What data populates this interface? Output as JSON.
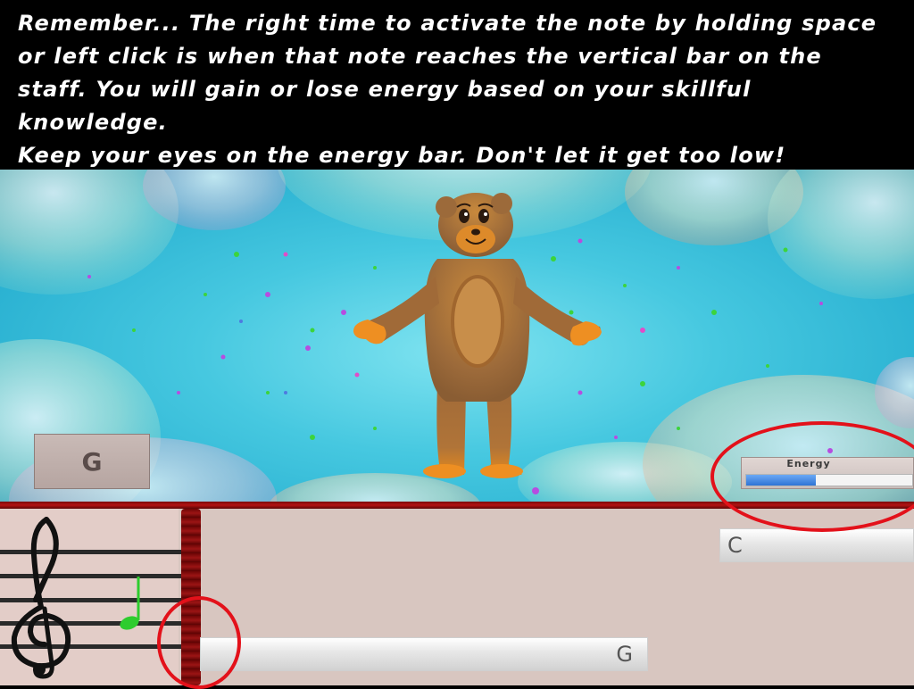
{
  "instructions": {
    "line1": "Remember... The right time to activate the note by holding space",
    "line2": "or left click is when that note reaches the vertical bar on the",
    "line3": "staff. You will gain or lose energy based on your skillful knowledge.",
    "line4": "Keep your eyes on the energy bar. Don't let it get too low!"
  },
  "current_note": {
    "label": "G"
  },
  "energy": {
    "label": "Energy",
    "level_percent": 42,
    "fill_color": "#3a7fe0"
  },
  "notes": [
    {
      "label": "C"
    },
    {
      "label": "G"
    }
  ],
  "colors": {
    "hit_bar": "#7a0a0a",
    "marker": "#e3111a",
    "note_head": "#2ecc2e",
    "stage_bg": "#3cc0de"
  },
  "icons": {
    "clef": "treble-clef",
    "character": "bear",
    "note": "quarter-note"
  }
}
